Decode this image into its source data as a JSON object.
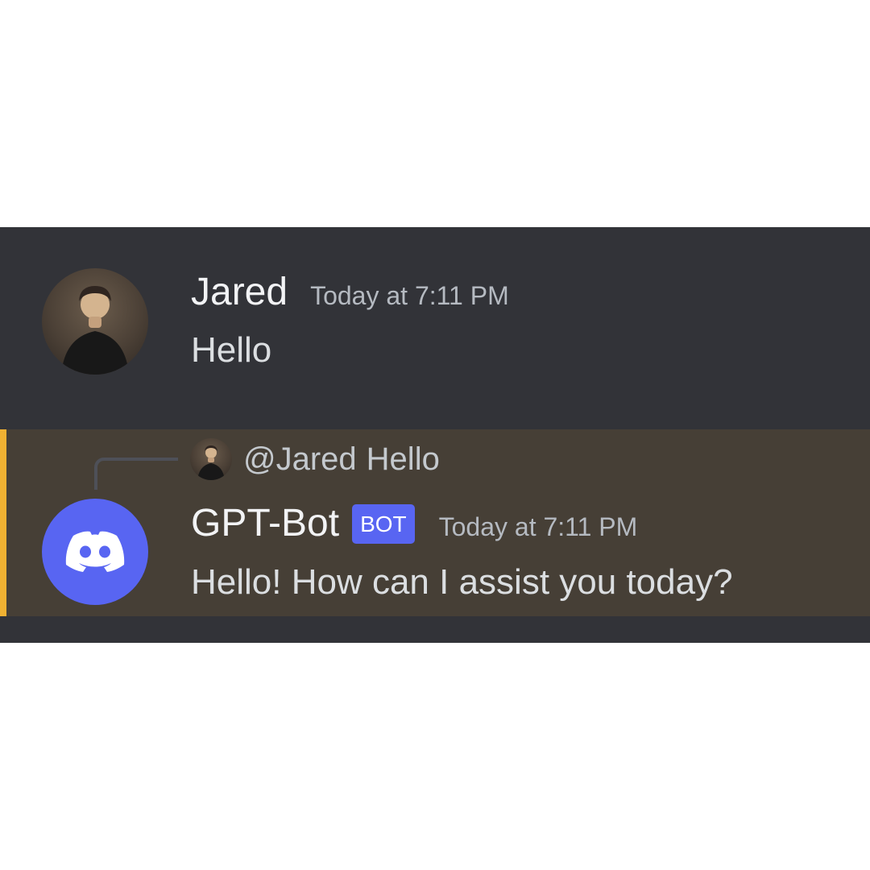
{
  "colors": {
    "background": "#ffffff",
    "chat_background": "#323338",
    "highlight_background": "#463f36",
    "highlight_bar": "#f0b132",
    "accent": "#5865f2",
    "username": "#f2f3f5",
    "message_text": "#dbdee1",
    "timestamp": "#b5bac1"
  },
  "messages": {
    "user": {
      "avatar_icon": "user-photo-avatar",
      "author": "Jared",
      "timestamp": "Today at 7:11 PM",
      "text": "Hello"
    },
    "bot": {
      "reply": {
        "avatar_icon": "user-photo-avatar",
        "author": "@Jared",
        "preview": "Hello"
      },
      "avatar_icon": "discord-logo-icon",
      "author": "GPT-Bot",
      "badge": "BOT",
      "timestamp": "Today at 7:11 PM",
      "text": "Hello! How can I assist you today?"
    }
  }
}
